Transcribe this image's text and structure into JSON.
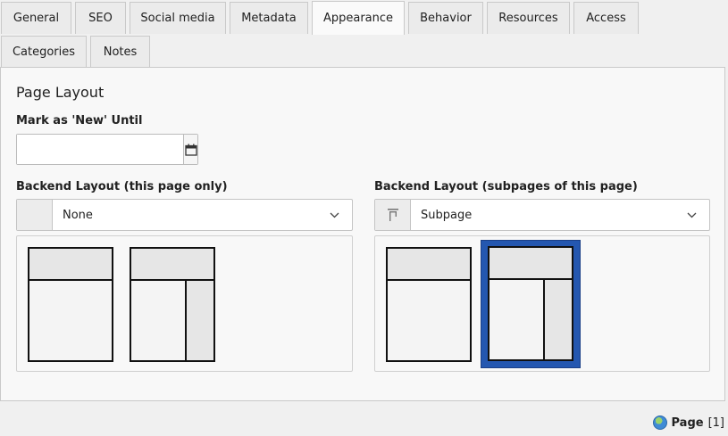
{
  "tabs": [
    {
      "label": "General"
    },
    {
      "label": "SEO"
    },
    {
      "label": "Social media"
    },
    {
      "label": "Metadata"
    },
    {
      "label": "Appearance",
      "active": true
    },
    {
      "label": "Behavior"
    },
    {
      "label": "Resources"
    },
    {
      "label": "Access"
    },
    {
      "label": "Categories"
    },
    {
      "label": "Notes"
    }
  ],
  "panel": {
    "section_title": "Page Layout",
    "new_until": {
      "label": "Mark as 'New' Until",
      "value": "",
      "button_icon": "calendar-icon"
    },
    "backend_layout": {
      "label": "Backend Layout (this page only)",
      "selected": "None",
      "options_shown": [
        "layout-header-single-column",
        "layout-header-two-column"
      ]
    },
    "backend_layout_subpages": {
      "label": "Backend Layout (subpages of this page)",
      "selected": "Subpage",
      "selected_thumb": "layout-header-two-column",
      "options_shown": [
        "layout-header-single-column",
        "layout-header-two-column"
      ]
    }
  },
  "footer": {
    "record_type": "Page",
    "record_id": "[1]",
    "icon": "globe-icon"
  },
  "colors": {
    "selected_frame": "#2457b0",
    "panel_bg": "#f8f8f8",
    "page_bg": "#f0f0f0"
  }
}
